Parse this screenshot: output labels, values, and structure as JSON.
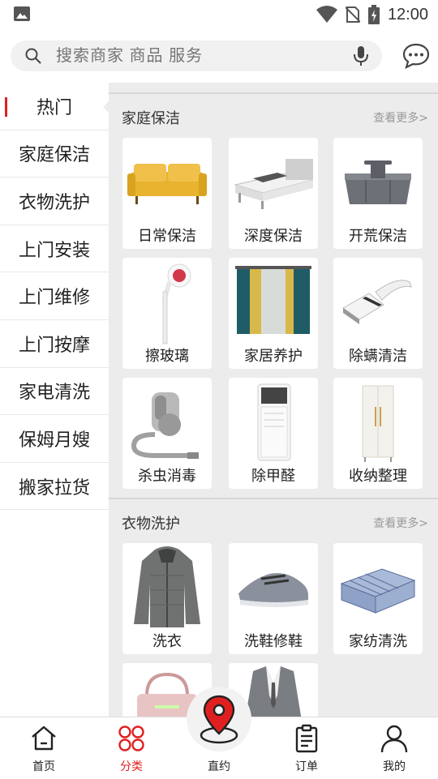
{
  "status": {
    "time": "12:00"
  },
  "search": {
    "placeholder": "搜索商家 商品 服务"
  },
  "sidebar": {
    "items": [
      {
        "label": "热门"
      },
      {
        "label": "家庭保洁"
      },
      {
        "label": "衣物洗护"
      },
      {
        "label": "上门安装"
      },
      {
        "label": "上门维修"
      },
      {
        "label": "上门按摩"
      },
      {
        "label": "家电清洗"
      },
      {
        "label": "保姆月嫂"
      },
      {
        "label": "搬家拉货"
      }
    ]
  },
  "sections": [
    {
      "title": "家庭保洁",
      "more": "查看更多>",
      "tiles": [
        {
          "label": "日常保洁",
          "icon": "sofa-image"
        },
        {
          "label": "深度保洁",
          "icon": "bed-image"
        },
        {
          "label": "开荒保洁",
          "icon": "tool-caddy-image"
        },
        {
          "label": "擦玻璃",
          "icon": "window-wiper-image"
        },
        {
          "label": "家居养护",
          "icon": "curtain-image"
        },
        {
          "label": "除螨清洁",
          "icon": "mite-vacuum-image"
        },
        {
          "label": "杀虫消毒",
          "icon": "sprayer-image"
        },
        {
          "label": "除甲醛",
          "icon": "air-purifier-image"
        },
        {
          "label": "收纳整理",
          "icon": "wardrobe-image"
        }
      ]
    },
    {
      "title": "衣物洗护",
      "more": "查看更多>",
      "tiles": [
        {
          "label": "洗衣",
          "icon": "jacket-image"
        },
        {
          "label": "洗鞋修鞋",
          "icon": "sneaker-image"
        },
        {
          "label": "家纺清洗",
          "icon": "blanket-image"
        },
        {
          "label": "",
          "icon": "handbag-image"
        },
        {
          "label": "",
          "icon": "suit-image"
        }
      ]
    }
  ],
  "tabbar": {
    "items": [
      {
        "label": "首页",
        "icon": "home-icon"
      },
      {
        "label": "分类",
        "icon": "category-icon"
      },
      {
        "label": "直约",
        "icon": "location-pin-icon"
      },
      {
        "label": "订单",
        "icon": "order-icon"
      },
      {
        "label": "我的",
        "icon": "profile-icon"
      }
    ]
  },
  "colors": {
    "accent": "#e02020",
    "content_bg": "#ececec"
  }
}
